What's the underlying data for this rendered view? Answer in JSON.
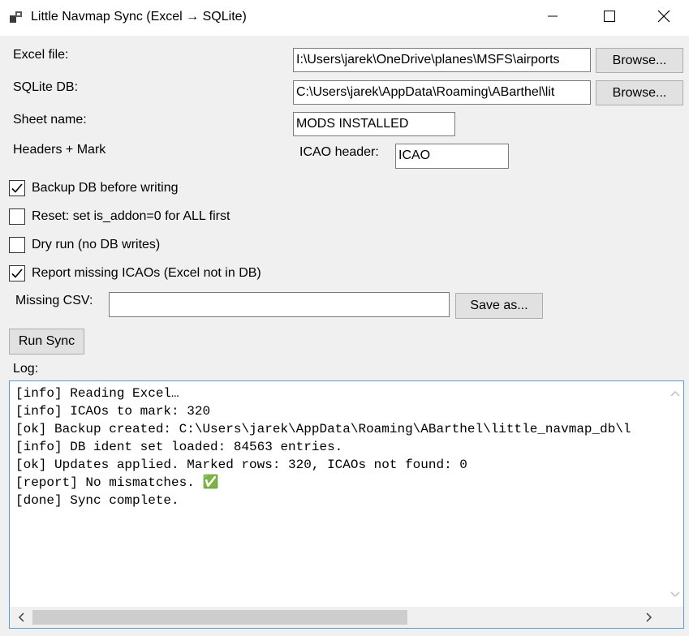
{
  "window": {
    "title": "Little Navmap Sync (Excel → SQLite)",
    "icons": {
      "app": "app-icon",
      "minimize": "minimize-icon",
      "maximize": "maximize-icon",
      "close": "close-icon"
    }
  },
  "form": {
    "excel_label": "Excel file:",
    "excel_value": "I:\\Users\\jarek\\OneDrive\\planes\\MSFS\\airports",
    "excel_browse": "Browse...",
    "sqlite_label": "SQLite DB:",
    "sqlite_value": "C:\\Users\\jarek\\AppData\\Roaming\\ABarthel\\lit",
    "sqlite_browse": "Browse...",
    "sheet_label": "Sheet name:",
    "sheet_value": "MODS INSTALLED",
    "headers_label": "Headers + Mark",
    "icao_header_label": "ICAO header:",
    "icao_header_value": "ICAO"
  },
  "options": [
    {
      "label": "Backup DB before writing",
      "checked": true
    },
    {
      "label": "Reset: set is_addon=0 for ALL first",
      "checked": false
    },
    {
      "label": "Dry run (no DB writes)",
      "checked": false
    },
    {
      "label": "Report missing ICAOs (Excel not in DB)",
      "checked": true
    }
  ],
  "missing": {
    "label": "Missing CSV:",
    "value": "",
    "save_button": "Save as..."
  },
  "run_button": "Run Sync",
  "log": {
    "label": "Log:",
    "lines": [
      "[info] Reading Excel…",
      "[info] ICAOs to mark: 320",
      "[ok] Backup created: C:\\Users\\jarek\\AppData\\Roaming\\ABarthel\\little_navmap_db\\l",
      "[info] DB ident set loaded: 84563 entries.",
      "[ok] Updates applied. Marked rows: 320, ICAOs not found: 0",
      "[report] No mismatches. ✅",
      "[done] Sync complete."
    ],
    "horizontal_scroll_fraction": 0.57
  },
  "colors": {
    "window_bg": "#f0f0f0",
    "titlebar_bg": "#ffffff",
    "log_border": "#5b9bd5",
    "button_bg": "#e1e1e1"
  }
}
